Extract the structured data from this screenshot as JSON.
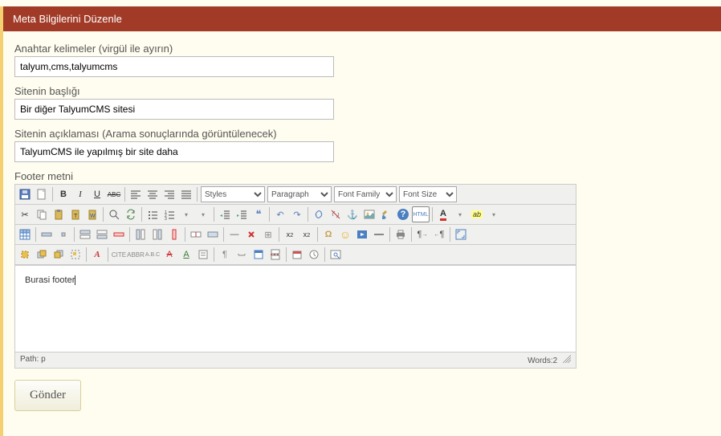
{
  "header": {
    "title": "Meta Bilgilerini Düzenle"
  },
  "fields": {
    "keywords": {
      "label": "Anahtar kelimeler (virgül ile ayırın)",
      "value": "talyum,cms,talyumcms"
    },
    "title": {
      "label": "Sitenin başlığı",
      "value": "Bir diğer TalyumCMS sitesi"
    },
    "desc": {
      "label": "Sitenin açıklaması (Arama sonuçlarında görüntülenecek)",
      "value": "TalyumCMS ile yapılmış bir site daha"
    },
    "footer": {
      "label": "Footer metni"
    }
  },
  "editor": {
    "selects": {
      "styles": "Styles",
      "paragraph": "Paragraph",
      "fontfamily": "Font Family",
      "fontsize": "Font Size"
    },
    "content": "Burasi footer",
    "status": {
      "path": "Path: p",
      "words": "Words:2"
    }
  },
  "submit": {
    "label": "Gönder"
  },
  "icons": {
    "bold": "B",
    "italic": "I",
    "underline": "U",
    "strike": "ABC",
    "alignleft": "≡",
    "aligncenter": "≡",
    "alignright": "≡",
    "alignjustify": "≡",
    "cut": "✂",
    "copy": "❐",
    "paste": "📋",
    "pastetext": "📋",
    "pasteword": "📋",
    "search": "🔍",
    "replace": "🔁",
    "bullist": "•≡",
    "numlist": "1≡",
    "outdent": "⇤",
    "indent": "⇥",
    "block": "❝",
    "undo": "↶",
    "redo": "↷",
    "link": "🔗",
    "unlink": "⛓",
    "anchor": "⚓",
    "image": "🖼",
    "clean": "🧹",
    "help": "?",
    "code": "HTML",
    "hr": "—",
    "remove": "✕",
    "visual": "¶",
    "sub": "x₂",
    "sup": "x²",
    "char": "Ω",
    "smiley": "☺",
    "date": "📅",
    "time": "🕓",
    "preview": "🔎",
    "color": "A",
    "bgcolor": "ab",
    "table": "▦",
    "row1": "▭",
    "row2": "▭",
    "row3": "▭",
    "col1": "▯",
    "col2": "▯",
    "col3": "▯",
    "split": "⬚",
    "merge": "⬚",
    "eraser": "◫",
    "layer": "◧",
    "abs": "⬚",
    "fwd": "▲",
    "back": "▼",
    "ltr": "¶→",
    "rtl": "←¶",
    "style2": "Aᵢ",
    "cite": "“”",
    "abbr": "A.",
    "acr": "A.",
    "del2": "A",
    "ins2": "A",
    "attr": "⚙",
    "vis2": "🖵",
    "nbsp": "⎵",
    "tpl": "▤",
    "pgb": "—",
    "full": "⛶",
    "new": "✎",
    "save": "💾"
  }
}
